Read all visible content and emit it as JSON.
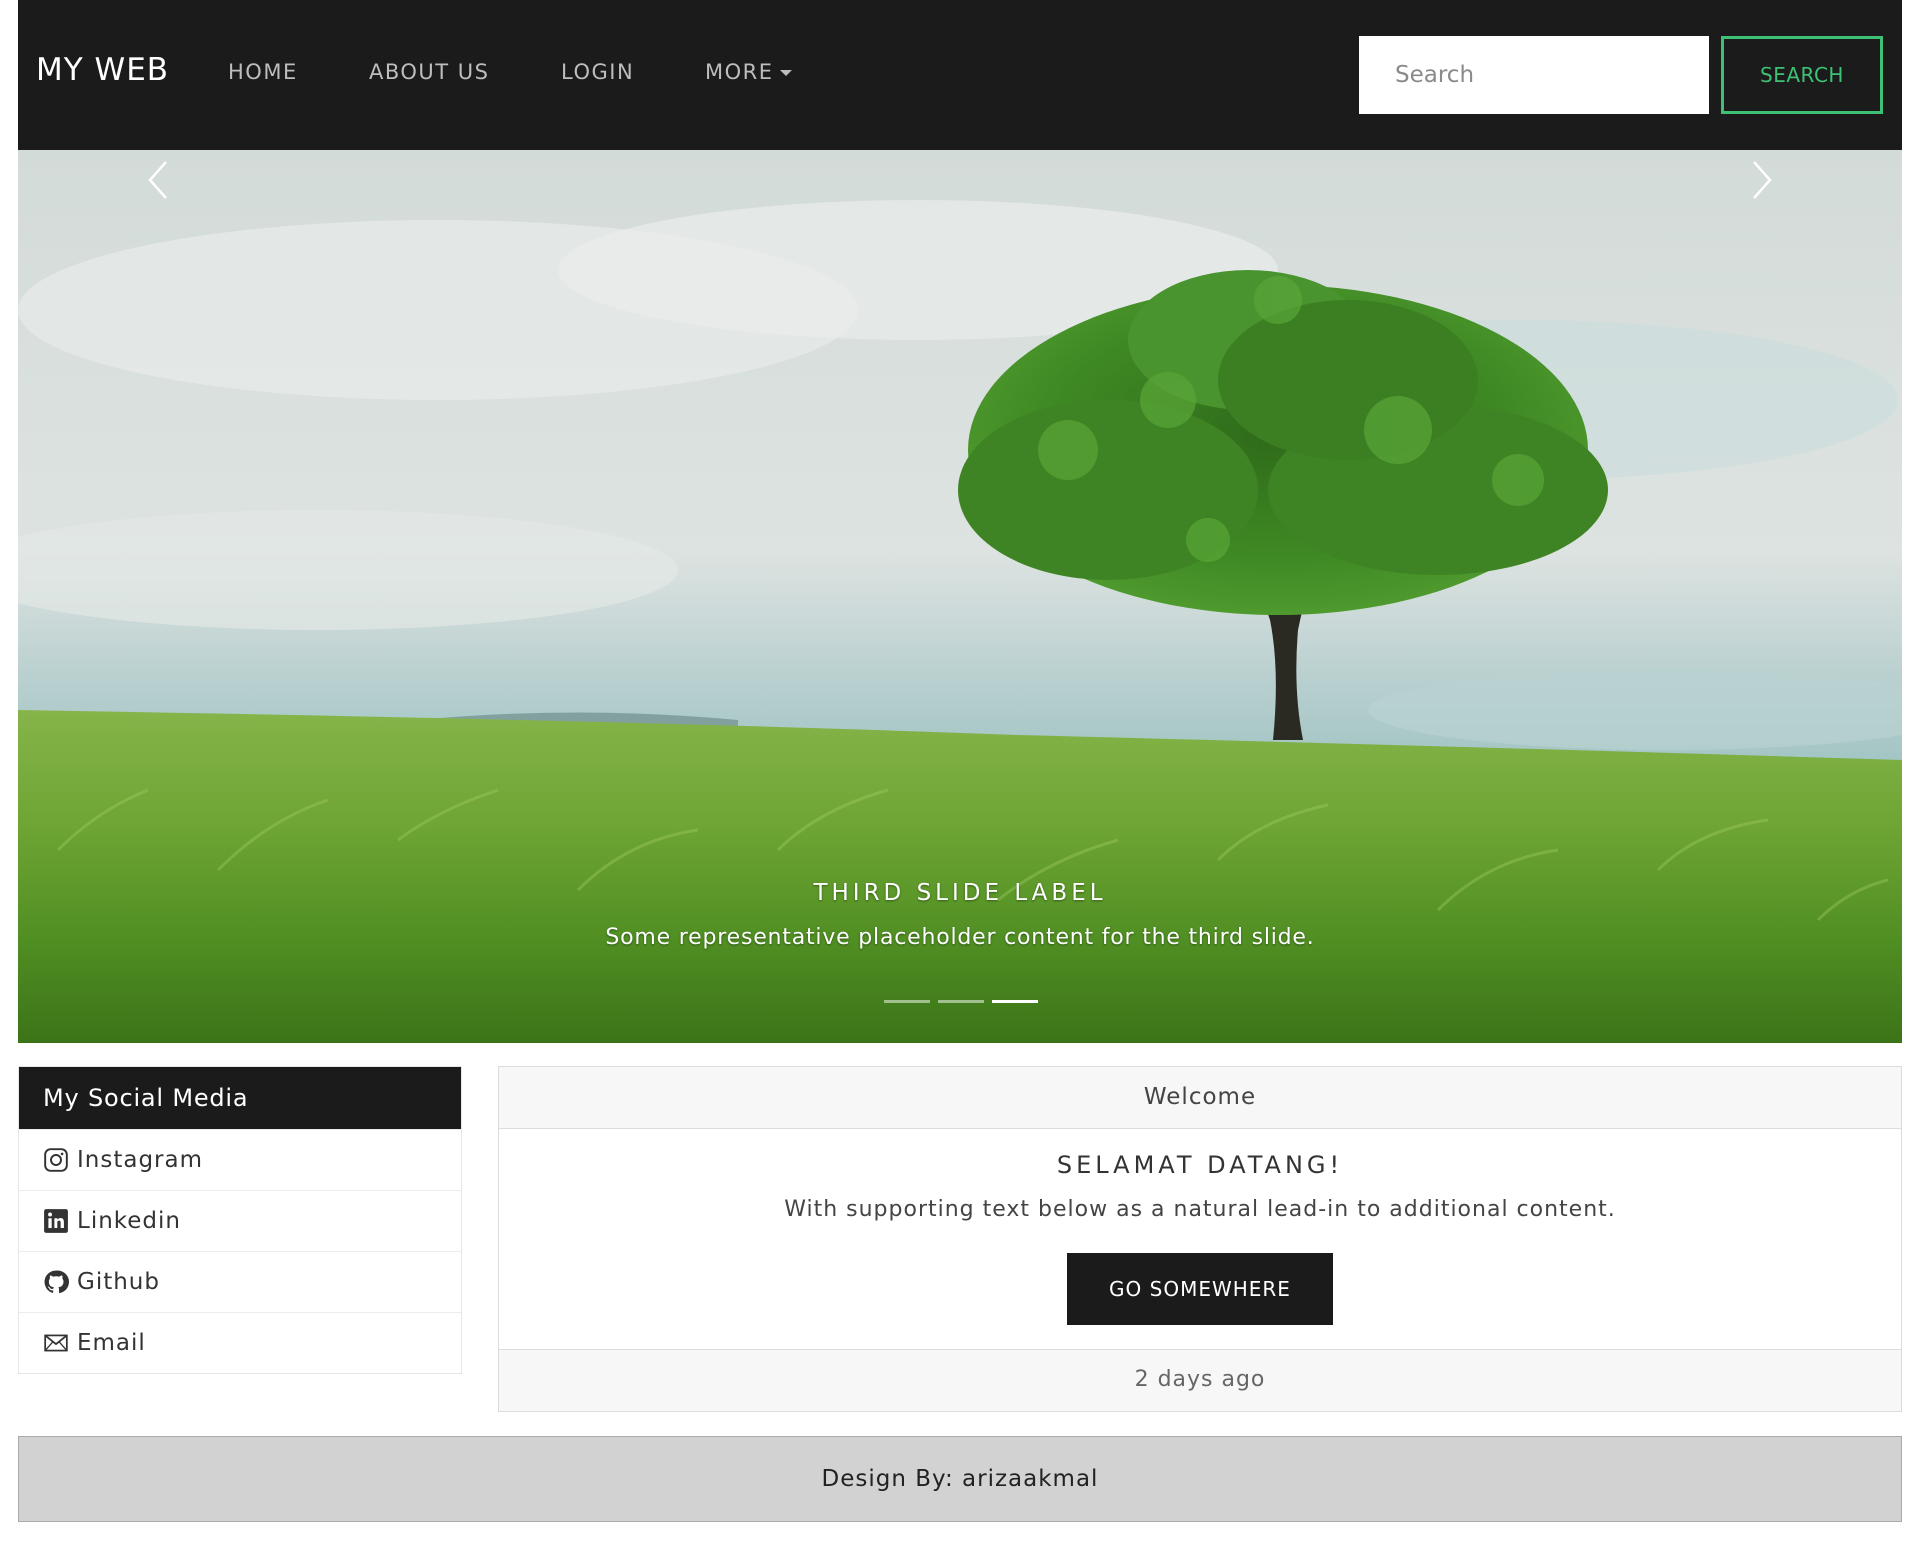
{
  "navbar": {
    "brand": "MY WEB",
    "items": [
      "HOME",
      "ABOUT US",
      "LOGIN",
      "MORE"
    ],
    "search_placeholder": "Search",
    "search_button": "SEARCH",
    "accent_color": "#3ec174"
  },
  "carousel": {
    "caption_title": "THIRD SLIDE LABEL",
    "caption_text": "Some representative placeholder content for the third slide.",
    "slide_count": 3,
    "active_slide": 3
  },
  "social": {
    "header": "My Social Media",
    "items": [
      {
        "label": "Instagram",
        "icon": "instagram-icon"
      },
      {
        "label": "Linkedin",
        "icon": "linkedin-icon"
      },
      {
        "label": "Github",
        "icon": "github-icon"
      },
      {
        "label": "Email",
        "icon": "email-icon"
      }
    ]
  },
  "card": {
    "header": "Welcome",
    "title": "SELAMAT DATANG!",
    "text": "With supporting text below as a natural lead-in to additional content.",
    "button": "GO SOMEWHERE",
    "footer": "2 days ago"
  },
  "footer": {
    "text": "Design By: arizaakmal"
  }
}
